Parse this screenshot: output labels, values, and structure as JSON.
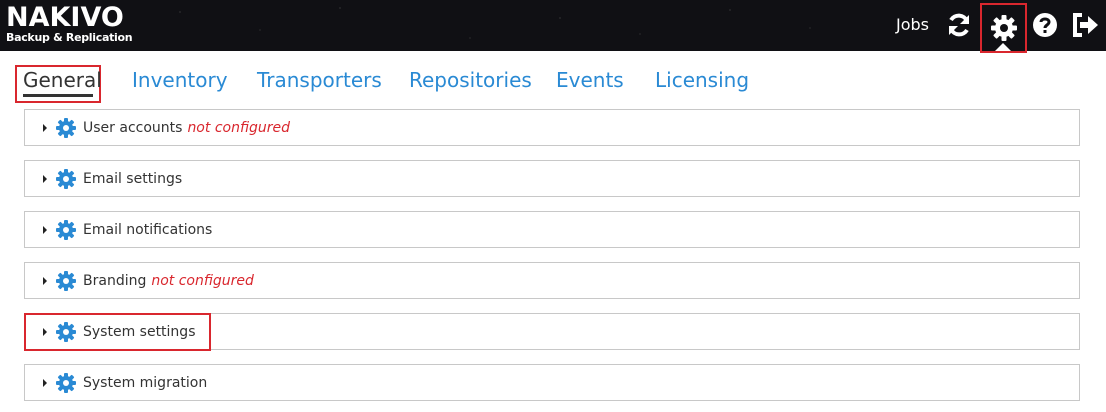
{
  "app": {
    "logo_main": "NAKIVO",
    "logo_sub": "Backup & Replication"
  },
  "topbar": {
    "jobs_label": "Jobs",
    "icons": [
      "refresh-icon",
      "gear-icon",
      "help-icon",
      "logout-icon"
    ]
  },
  "tabs": [
    {
      "label": "General",
      "active": true
    },
    {
      "label": "Inventory"
    },
    {
      "label": "Transporters"
    },
    {
      "label": "Repositories"
    },
    {
      "label": "Events"
    },
    {
      "label": "Licensing"
    }
  ],
  "sections": [
    {
      "label": "User accounts",
      "status": "not configured"
    },
    {
      "label": "Email settings",
      "status": ""
    },
    {
      "label": "Email notifications",
      "status": ""
    },
    {
      "label": "Branding",
      "status": "not configured"
    },
    {
      "label": "System settings",
      "status": ""
    },
    {
      "label": "System migration",
      "status": ""
    }
  ],
  "colors": {
    "accent": "#2a8ad4",
    "highlight": "#d9272e",
    "topbar": "#101014"
  }
}
